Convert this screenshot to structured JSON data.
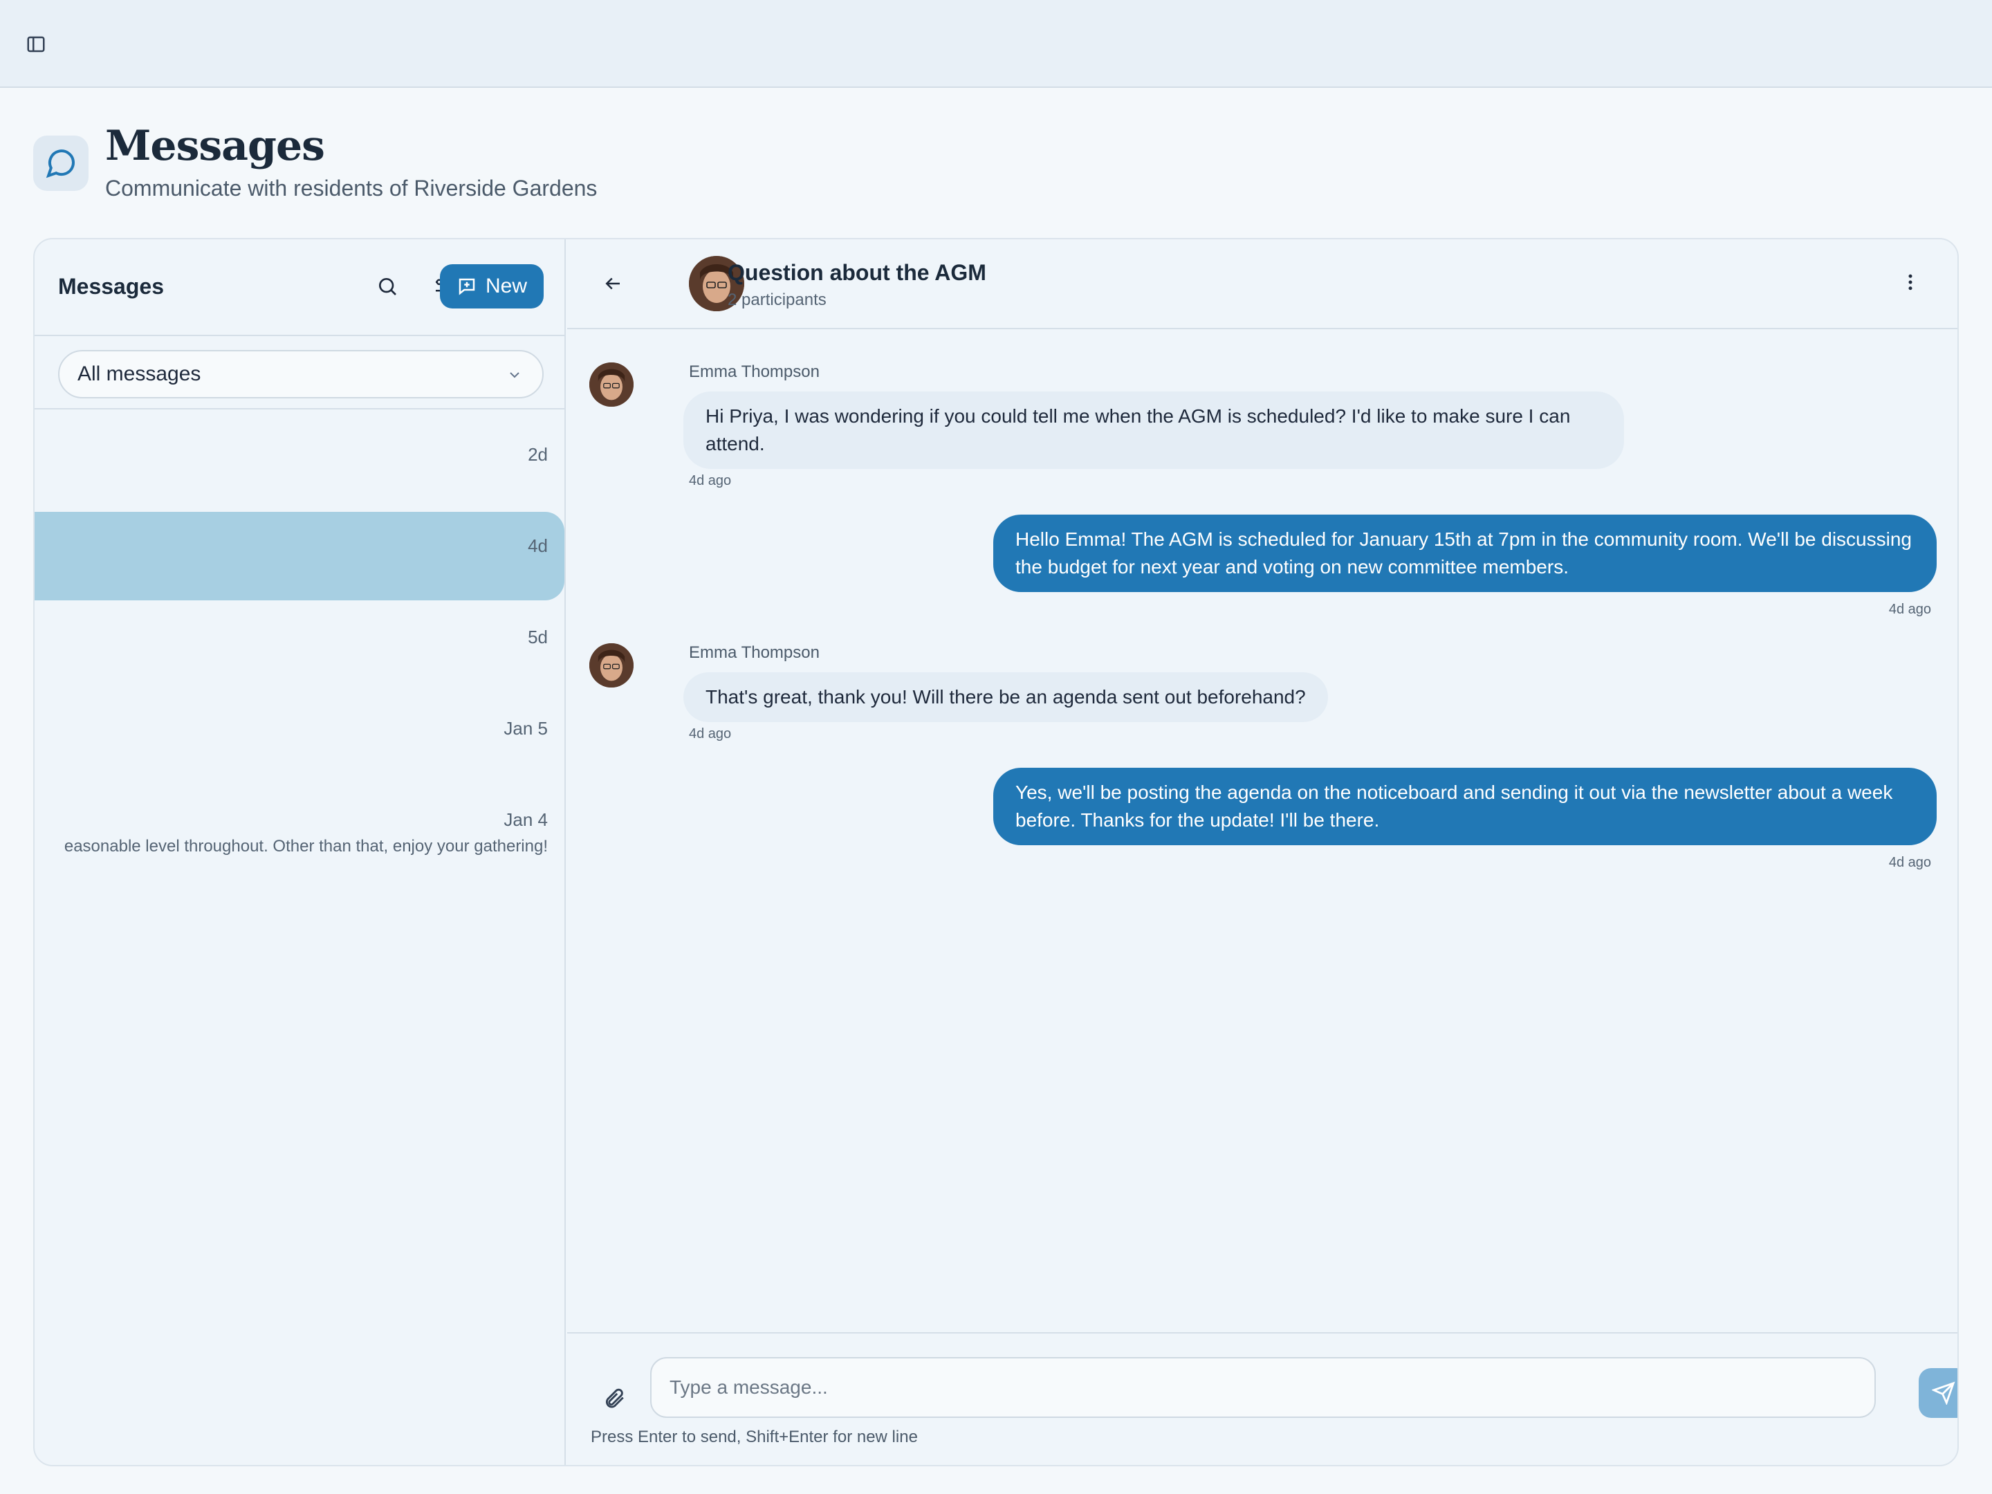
{
  "page": {
    "title": "Messages",
    "subtitle": "Communicate with residents of Riverside Gardens"
  },
  "left": {
    "title": "Messages",
    "new_label": "New",
    "filter_value": "All messages",
    "conversations": [
      {
        "time": "2d",
        "preview": ""
      },
      {
        "time": "4d",
        "preview": "",
        "active": true
      },
      {
        "time": "5d",
        "preview": ""
      },
      {
        "time": "Jan 5",
        "preview": ""
      },
      {
        "time": "Jan 4",
        "preview": "easonable level throughout. Other than that, enjoy your gathering!"
      }
    ]
  },
  "chat": {
    "title": "Question about the AGM",
    "participants": "2 participants",
    "messages": [
      {
        "direction": "in",
        "sender": "Emma Thompson",
        "text": "Hi Priya, I was wondering if you could tell me when the AGM is scheduled? I'd like to make sure I can attend.",
        "time": "4d ago"
      },
      {
        "direction": "out",
        "text": "Hello Emma! The AGM is scheduled for January 15th at 7pm in the community room. We'll be discussing the budget for next year and voting on new committee members.",
        "time": "4d ago"
      },
      {
        "direction": "in",
        "sender": "Emma Thompson",
        "text": "That's great, thank you! Will there be an agenda sent out beforehand?",
        "time": "4d ago"
      },
      {
        "direction": "out",
        "text": "Yes, we'll be posting the agenda on the noticeboard and sending it out via the newsletter about a week before. Thanks for the update! I'll be there.",
        "time": "4d ago"
      }
    ],
    "input_placeholder": "Type a message...",
    "hint": "Press Enter to send, Shift+Enter for new line"
  },
  "colors": {
    "accent": "#2178b5",
    "active_row": "#a7cfe2",
    "background": "#f4f8fb"
  }
}
